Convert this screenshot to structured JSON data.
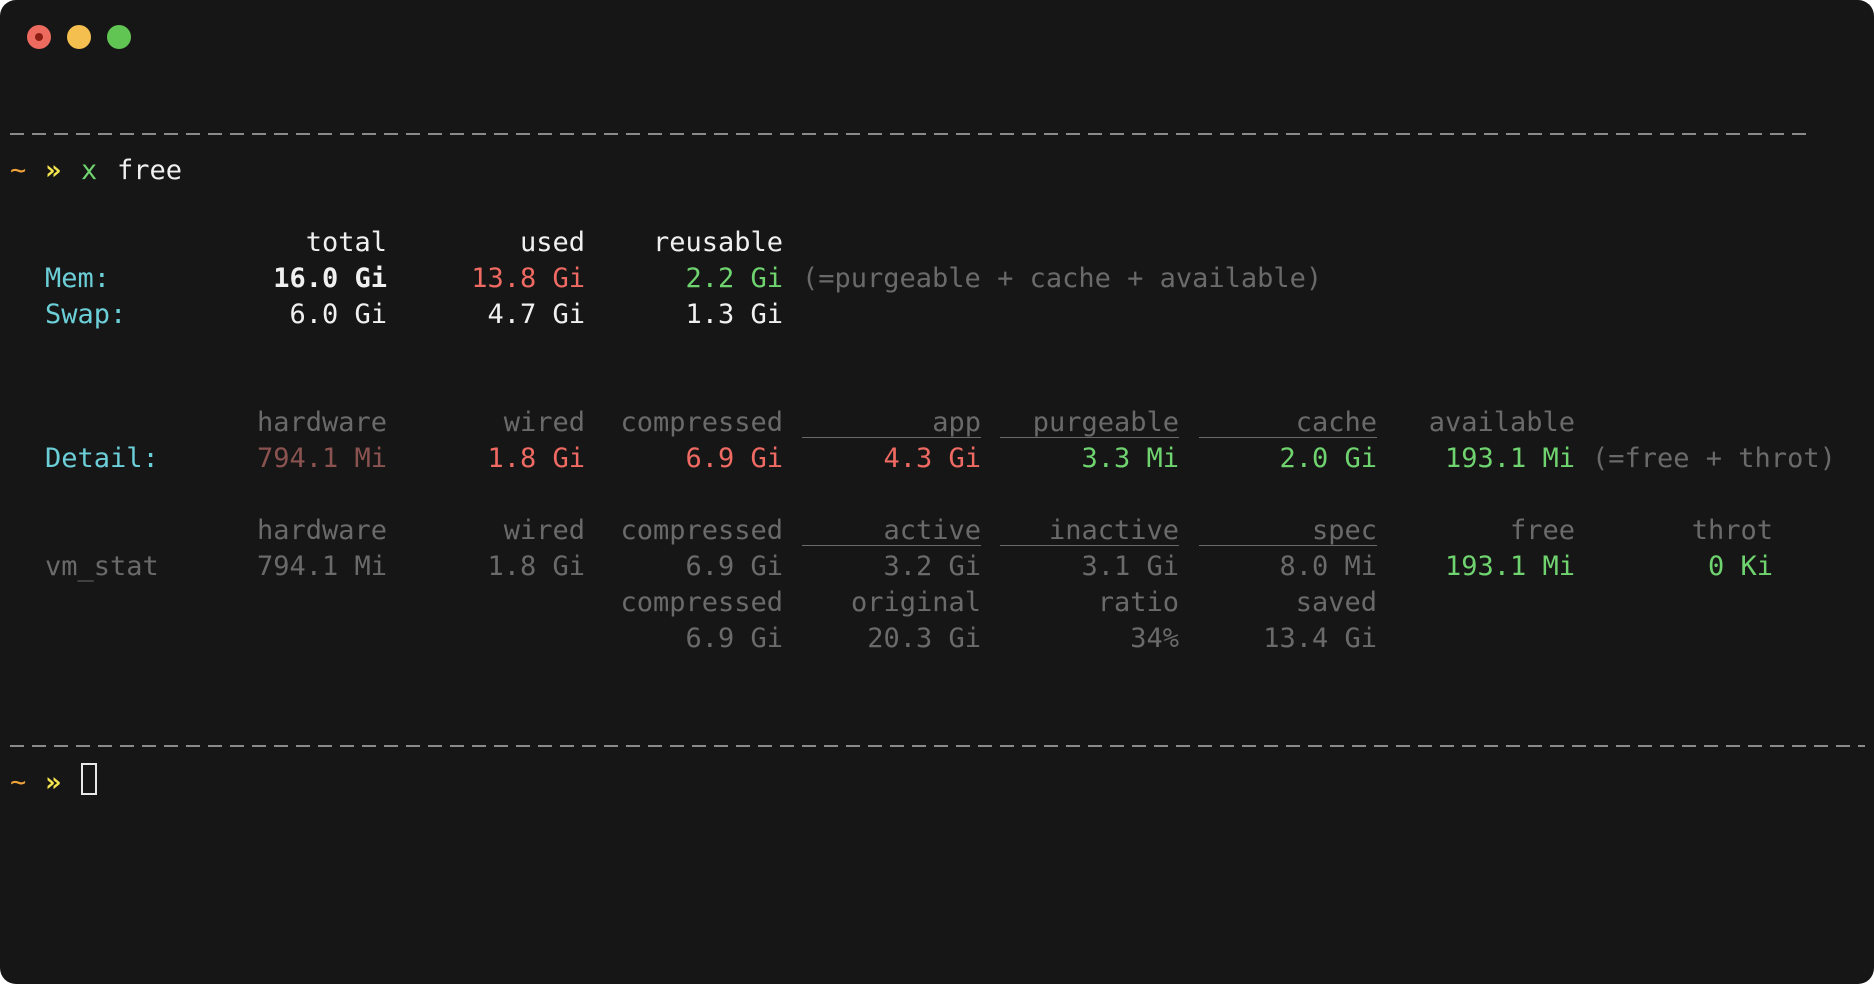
{
  "prompt": {
    "tilde": "~",
    "chevron": "»",
    "command_prefix": "x",
    "command": "free"
  },
  "summary": {
    "headers": [
      "total",
      "used",
      "reusable"
    ],
    "mem": {
      "label": "Mem:",
      "total": "16.0 Gi",
      "used": "13.8 Gi",
      "reusable": "2.2 Gi",
      "note": "(=purgeable + cache + available)"
    },
    "swap": {
      "label": "Swap:",
      "total": "6.0 Gi",
      "used": "4.7 Gi",
      "reusable": "1.3 Gi"
    }
  },
  "detail": {
    "label": "Detail:",
    "headers": [
      "hardware",
      "wired",
      "compressed",
      "app",
      "purgeable",
      "cache",
      "available"
    ],
    "values": [
      "794.1 Mi",
      "1.8 Gi",
      "6.9 Gi",
      "4.3 Gi",
      "3.3 Mi",
      "2.0 Gi",
      "193.1 Mi"
    ],
    "note": "(=free + throt)"
  },
  "vm_stat": {
    "label": "vm_stat",
    "headers": [
      "hardware",
      "wired",
      "compressed",
      "active",
      "inactive",
      "spec",
      "free",
      "throt"
    ],
    "values": [
      "794.1 Mi",
      "1.8 Gi",
      "6.9 Gi",
      "3.2 Gi",
      "3.1 Gi",
      "8.0 Mi",
      "193.1 Mi",
      "0 Ki"
    ],
    "compression_headers": [
      "compressed",
      "original",
      "ratio",
      "saved"
    ],
    "compression_values": [
      "6.9 Gi",
      "20.3 Gi",
      "34%",
      "13.4 Gi"
    ]
  },
  "prompt2": {
    "tilde": "~",
    "chevron": "»"
  },
  "colors": {
    "background": "#161616",
    "orange": "#f0a33a",
    "yellow": "#f5e64f",
    "green": "#6fd36f",
    "cyan": "#6ccfd8",
    "red": "#ee6a62",
    "dim": "#6a6a6a"
  }
}
